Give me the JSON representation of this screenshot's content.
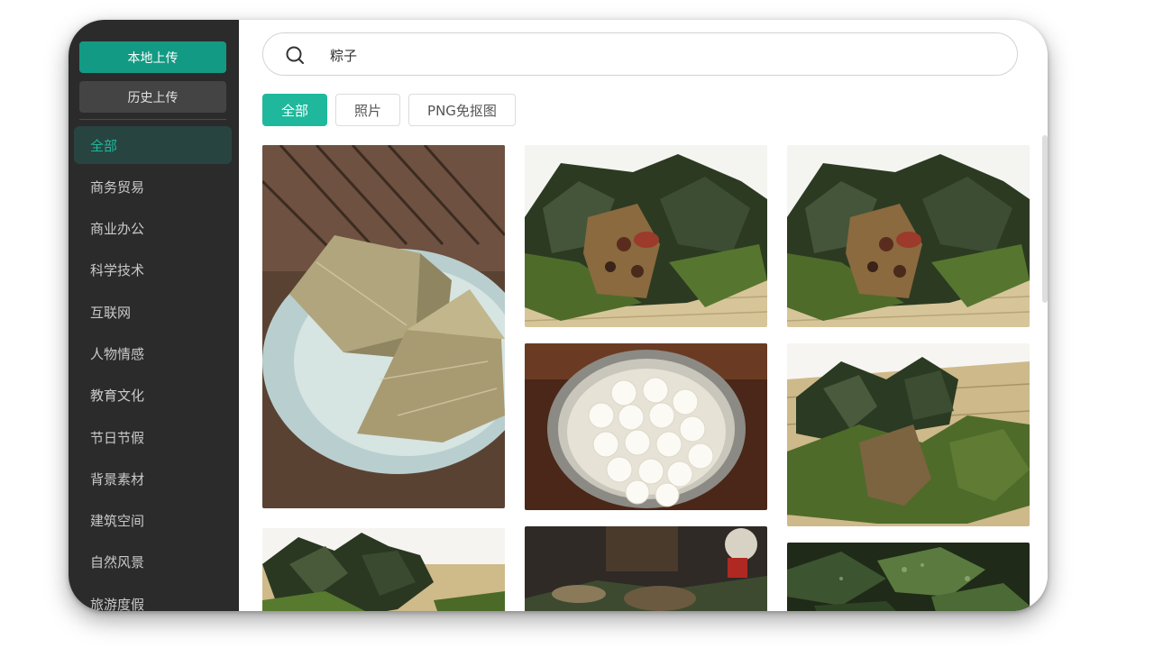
{
  "sidebar": {
    "upload_label": "本地上传",
    "history_label": "历史上传",
    "categories": [
      "全部",
      "商务贸易",
      "商业办公",
      "科学技术",
      "互联网",
      "人物情感",
      "教育文化",
      "节日节假",
      "背景素材",
      "建筑空间",
      "自然风景",
      "旅游度假"
    ]
  },
  "search": {
    "value": "粽子"
  },
  "tabs": [
    "全部",
    "照片",
    "PNG免抠图"
  ],
  "colors": {
    "accent": "#1fb89c",
    "upload_button": "#139a84",
    "sidebar_bg": "#2b2b2b"
  },
  "images": [
    {
      "name": "zongzi-bowl-photo"
    },
    {
      "name": "zongzi-leaves-photo"
    },
    {
      "name": "zongzi-leaves-photo-copy"
    },
    {
      "name": "tangyuan-pot-photo"
    },
    {
      "name": "zongzi-mat-photo"
    },
    {
      "name": "zongzi-pile-photo"
    },
    {
      "name": "zongzi-table-photo"
    },
    {
      "name": "green-leaves-photo"
    }
  ]
}
